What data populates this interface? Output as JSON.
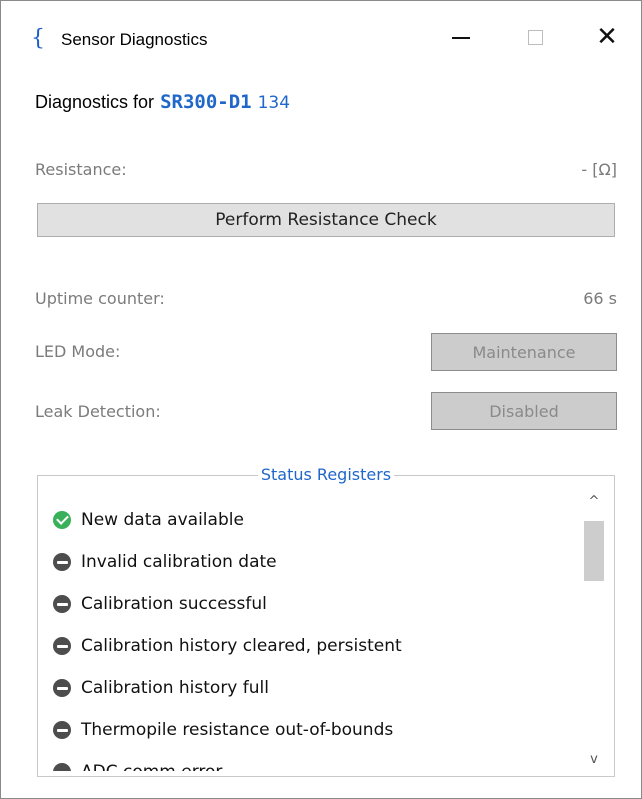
{
  "window": {
    "title": "Sensor Diagnostics",
    "app_icon": "{",
    "minimize_glyph": "",
    "close_glyph": "✕"
  },
  "heading": {
    "prefix": "Diagnostics for",
    "model": "SR300-D1",
    "serial": "134"
  },
  "resistance": {
    "label": "Resistance:",
    "value": "-   [Ω]",
    "button_label": "Perform Resistance Check"
  },
  "uptime": {
    "label": "Uptime counter:",
    "value": "66 s"
  },
  "led_mode": {
    "label": "LED Mode:",
    "button_label": "Maintenance"
  },
  "leak_detection": {
    "label": "Leak Detection:",
    "button_label": "Disabled"
  },
  "status_registers": {
    "title": "Status Registers",
    "items": [
      {
        "label": "New data available",
        "state": "active",
        "icon": "check-circle-icon"
      },
      {
        "label": "Invalid calibration date",
        "state": "inactive",
        "icon": "minus-circle-icon"
      },
      {
        "label": "Calibration successful",
        "state": "inactive",
        "icon": "minus-circle-icon"
      },
      {
        "label": "Calibration history cleared, persistent",
        "state": "inactive",
        "icon": "minus-circle-icon"
      },
      {
        "label": "Calibration history full",
        "state": "inactive",
        "icon": "minus-circle-icon"
      },
      {
        "label": "Thermopile resistance out-of-bounds",
        "state": "inactive",
        "icon": "minus-circle-icon"
      },
      {
        "label": "ADC comm error",
        "state": "inactive",
        "icon": "minus-circle-icon"
      }
    ],
    "scroll_up": "^",
    "scroll_down": "v"
  },
  "colors": {
    "accent": "#1f67c9",
    "ok": "#39b05a",
    "inactive": "#4d4d4d"
  }
}
